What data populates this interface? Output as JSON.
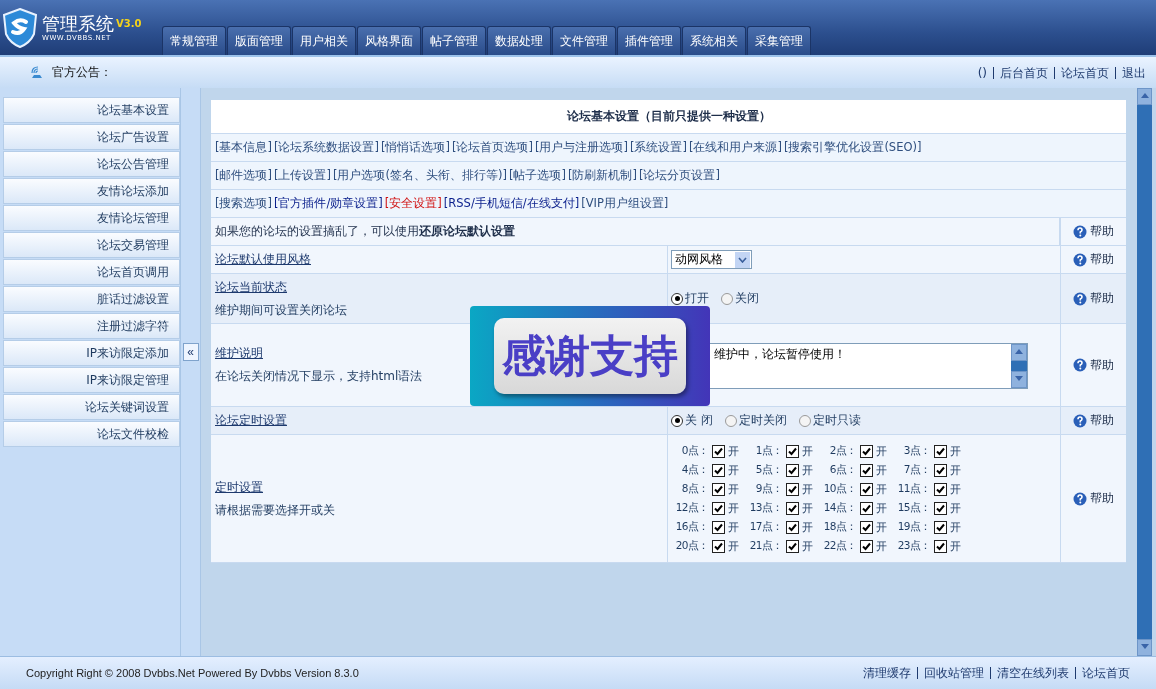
{
  "brand": {
    "title": "管理系统",
    "version": "V3.0",
    "site": "WWW.DVBBS.NET"
  },
  "tabs": [
    {
      "label": "常规管理",
      "selected": false
    },
    {
      "label": "版面管理",
      "selected": false
    },
    {
      "label": "用户相关",
      "selected": false
    },
    {
      "label": "风格界面",
      "selected": false
    },
    {
      "label": "帖子管理",
      "selected": false
    },
    {
      "label": "数据处理",
      "selected": false
    },
    {
      "label": "文件管理",
      "selected": false
    },
    {
      "label": "插件管理",
      "selected": false
    },
    {
      "label": "系统相关",
      "selected": false
    },
    {
      "label": "采集管理",
      "selected": false
    }
  ],
  "notice_bar": {
    "label": "官方公告：",
    "links": [
      "()",
      "后台首页",
      "论坛首页",
      "退出"
    ]
  },
  "sidebar": {
    "items": [
      "论坛基本设置",
      "论坛广告设置",
      "论坛公告管理",
      "友情论坛添加",
      "友情论坛管理",
      "论坛交易管理",
      "论坛首页调用",
      "脏话过滤设置",
      "注册过滤字符",
      "IP来访限定添加",
      "IP来访限定管理",
      "论坛关键词设置",
      "论坛文件校检"
    ],
    "collapse": "«"
  },
  "panel": {
    "title": "论坛基本设置（目前只提供一种设置）",
    "link_rows": [
      [
        {
          "label": "[基本信息]",
          "color": "#2f4f7f"
        },
        {
          "label": "[论坛系统数据设置]",
          "color": "#2f4f7f"
        },
        {
          "label": "[悄悄话选项]",
          "color": "#2f4f7f"
        },
        {
          "label": "[论坛首页选项]",
          "color": "#2f4f7f"
        },
        {
          "label": "[用户与注册选项]",
          "color": "#2f4f7f"
        },
        {
          "label": "[系统设置]",
          "color": "#2f4f7f"
        },
        {
          "label": "[在线和用户来源]",
          "color": "#2f4f7f"
        },
        {
          "label": "[搜索引擎优化设置(SEO)]",
          "color": "#2f4f7f"
        }
      ],
      [
        {
          "label": "[邮件选项]",
          "color": "#2f4f7f"
        },
        {
          "label": "[上传设置]",
          "color": "#2f4f7f"
        },
        {
          "label": "[用户选项(签名、头衔、排行等)]",
          "color": "#2f4f7f"
        },
        {
          "label": "[帖子选项]",
          "color": "#2f4f7f"
        },
        {
          "label": "[防刷新机制]",
          "color": "#2f4f7f"
        },
        {
          "label": "[论坛分页设置]",
          "color": "#2f4f7f"
        }
      ],
      [
        {
          "label": "[搜索选项]",
          "color": "#2f4f7f"
        },
        {
          "label": "[官方插件/勋章设置]",
          "color": "#0a1f8c"
        },
        {
          "label": "[安全设置]",
          "color": "#d01010"
        },
        {
          "label": "[RSS/手机短信/在线支付]",
          "color": "#0a1f8c"
        },
        {
          "label": "[VIP用户组设置]",
          "color": "#2f4f7f"
        }
      ]
    ],
    "restore_note": "如果您的论坛的设置搞乱了，可以使用**还原论坛默认设置**",
    "restore_help": "帮助",
    "settings": [
      {
        "kind": "select",
        "title": "论坛默认使用风格",
        "value": "动网风格",
        "help": "帮助"
      },
      {
        "kind": "radio",
        "title": "论坛当前状态",
        "desc": "维护期间可设置关闭论坛",
        "help": "帮助",
        "options": [
          {
            "label": "打开",
            "selected": true
          },
          {
            "label": "关闭",
            "selected": false
          }
        ]
      },
      {
        "kind": "textarea",
        "title": "维护说明",
        "desc": "在论坛关闭情况下显示，支持html语法",
        "help": "帮助",
        "value": "维护中，论坛暂停使用！"
      },
      {
        "kind": "radio",
        "title": "论坛定时设置",
        "help": "帮助",
        "options": [
          {
            "label": "关 闭",
            "selected": true
          },
          {
            "label": "定时关闭",
            "selected": false
          },
          {
            "label": "定时只读",
            "selected": false
          }
        ]
      },
      {
        "kind": "hours",
        "title": "定时设置",
        "desc": "请根据需要选择开或关",
        "help": "帮助",
        "hours": [
          {
            "label": "0点：",
            "checked": true,
            "text": "开"
          },
          {
            "label": "1点：",
            "checked": true,
            "text": "开"
          },
          {
            "label": "2点：",
            "checked": true,
            "text": "开"
          },
          {
            "label": "3点：",
            "checked": true,
            "text": "开"
          },
          {
            "label": "4点：",
            "checked": true,
            "text": "开"
          },
          {
            "label": "5点：",
            "checked": true,
            "text": "开"
          },
          {
            "label": "6点：",
            "checked": true,
            "text": "开"
          },
          {
            "label": "7点：",
            "checked": true,
            "text": "开"
          },
          {
            "label": "8点：",
            "checked": true,
            "text": "开"
          },
          {
            "label": "9点：",
            "checked": true,
            "text": "开"
          },
          {
            "label": "10点：",
            "checked": true,
            "text": "开"
          },
          {
            "label": "11点：",
            "checked": true,
            "text": "开"
          },
          {
            "label": "12点：",
            "checked": true,
            "text": "开"
          },
          {
            "label": "13点：",
            "checked": true,
            "text": "开"
          },
          {
            "label": "14点：",
            "checked": true,
            "text": "开"
          },
          {
            "label": "15点：",
            "checked": true,
            "text": "开"
          },
          {
            "label": "16点：",
            "checked": true,
            "text": "开"
          },
          {
            "label": "17点：",
            "checked": true,
            "text": "开"
          },
          {
            "label": "18点：",
            "checked": true,
            "text": "开"
          },
          {
            "label": "19点：",
            "checked": true,
            "text": "开"
          },
          {
            "label": "20点：",
            "checked": true,
            "text": "开"
          },
          {
            "label": "21点：",
            "checked": true,
            "text": "开"
          },
          {
            "label": "22点：",
            "checked": true,
            "text": "开"
          },
          {
            "label": "23点：",
            "checked": true,
            "text": "开"
          }
        ]
      }
    ]
  },
  "overlay": {
    "text": "感谢支持"
  },
  "footer": {
    "copyright": "Copyright Right © 2008 Dvbbs.Net Powered By Dvbbs Version 8.3.0",
    "links": [
      "清理缓存",
      "回收站管理",
      "清空在线列表",
      "论坛首页"
    ]
  }
}
